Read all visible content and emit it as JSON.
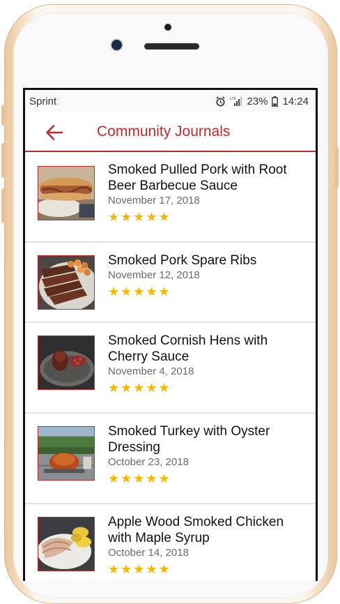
{
  "status_bar": {
    "carrier": "Sprint",
    "battery": "23%",
    "time": "14:24",
    "network": "LTE"
  },
  "app_bar": {
    "title": "Community Journals"
  },
  "journals": [
    {
      "title": "Smoked Pulled Pork with Root Beer Barbecue Sauce",
      "date": "November 17, 2018",
      "rating": 5,
      "stars": "★★★★★",
      "image": "pulled-pork-sandwich"
    },
    {
      "title": "Smoked Pork Spare Ribs",
      "date": "November 12, 2018",
      "rating": 5,
      "stars": "★★★★★",
      "image": "spare-ribs"
    },
    {
      "title": "Smoked Cornish Hens with Cherry Sauce",
      "date": "November 4, 2018",
      "rating": 5,
      "stars": "★★★★★",
      "image": "cornish-hens"
    },
    {
      "title": "Smoked Turkey with Oyster Dressing",
      "date": "October 23, 2018",
      "rating": 5,
      "stars": "★★★★★",
      "image": "smoked-turkey"
    },
    {
      "title": "Apple Wood Smoked Chicken with Maple Syrup",
      "date": "October 14, 2018",
      "rating": 5,
      "stars": "★★★★★",
      "image": "smoked-chicken"
    }
  ],
  "colors": {
    "accent": "#c62828",
    "star": "#f5b800",
    "divider": "#e2e2e2"
  }
}
